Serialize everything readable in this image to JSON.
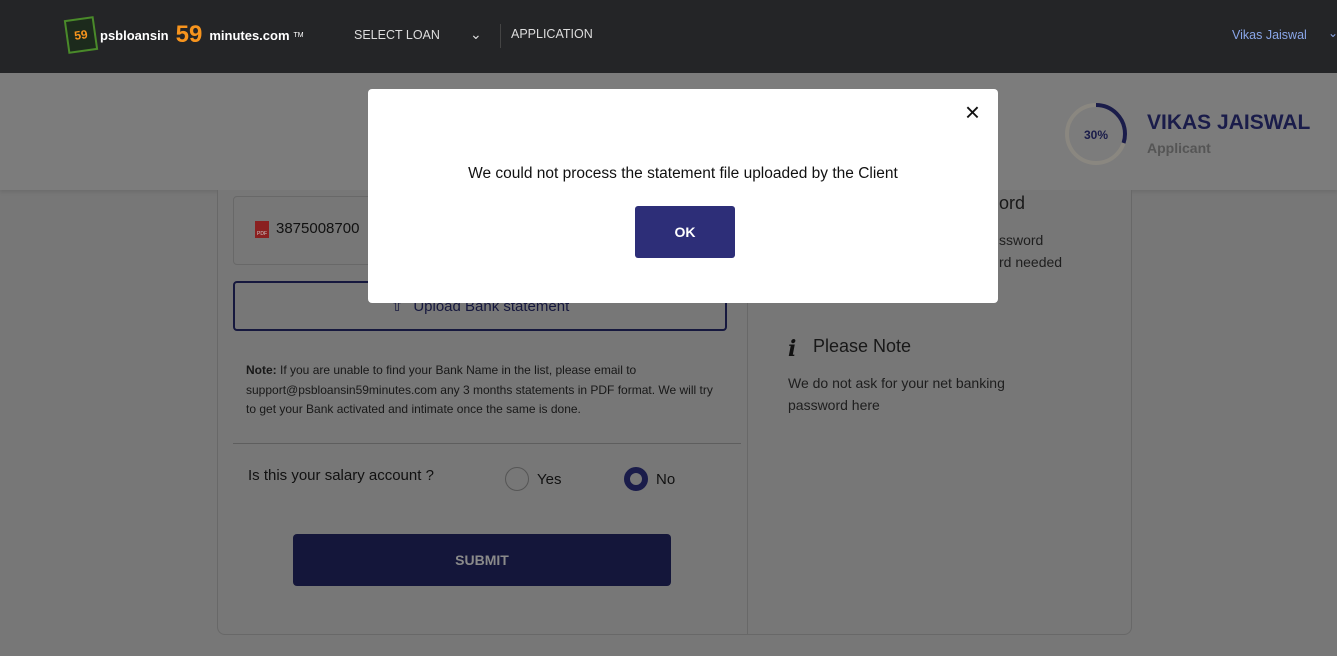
{
  "header": {
    "logo_text": "psbloansin",
    "logo_number": "59",
    "logo_domain": "minutes.com",
    "logo_tm": "TM",
    "logo_badge": "59",
    "nav": [
      "SELECT LOAN",
      "APPLICATION"
    ],
    "user": "Vikas Jaiswal"
  },
  "profile": {
    "progress_percent": 30,
    "progress_label": "30%",
    "name": "VIKAS JAISWAL",
    "role": "Applicant"
  },
  "form": {
    "file_name": "3875008700",
    "upload_label": "Upload Bank statement",
    "note_label": "Note:",
    "note_text": " If you are unable to find your Bank Name in the list, please email to support@psbloansin59minutes.com any 3 months statements in PDF format. We will try to get your Bank activated and intimate once the same is done.",
    "question": "Is this your salary account ?",
    "options": [
      "Yes",
      "No"
    ],
    "selected": "No",
    "submit": "SUBMIT"
  },
  "side": {
    "heading1_partial": "ord",
    "line1_partial": "ssword",
    "line2_partial": "rd needed",
    "heading2": "Please Note",
    "note_text": "We do not ask for your net banking password here"
  },
  "modal": {
    "message": "We could not process the statement file uploaded by the Client",
    "ok": "OK",
    "close": "×"
  },
  "colors": {
    "primary": "#2b2f7c",
    "header": "#242527",
    "accent": "#f7941d"
  }
}
